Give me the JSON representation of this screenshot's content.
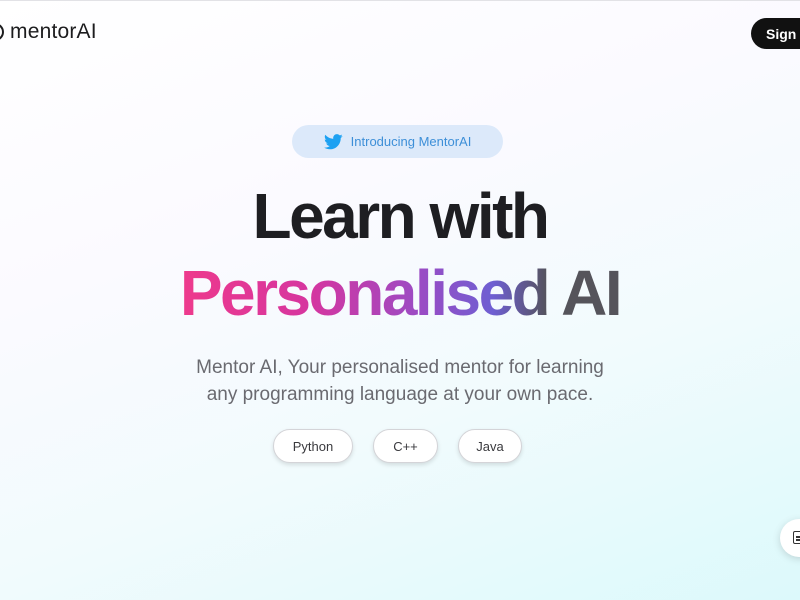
{
  "header": {
    "brand_name": "mentorAI",
    "sign_in_label": "Sign In"
  },
  "hero": {
    "intro_badge": {
      "icon": "twitter-bird-icon",
      "label": "Introducing MentorAI"
    },
    "headline_line1": "Learn with",
    "headline_line2_gradient": "Personalised",
    "headline_line2_plain": "AI",
    "subtitle_line1": "Mentor AI, Your personalised mentor for learning",
    "subtitle_line2": "any programming language at your own pace.",
    "languages": [
      "Python",
      "C++",
      "Java"
    ]
  },
  "floating_button": {
    "icon": "document-icon"
  },
  "colors": {
    "twitter_blue": "#1da1f2",
    "gradient_start": "#ee3a8c",
    "gradient_mid": "#9b4bc4",
    "gradient_end": "#6e5fd2"
  }
}
